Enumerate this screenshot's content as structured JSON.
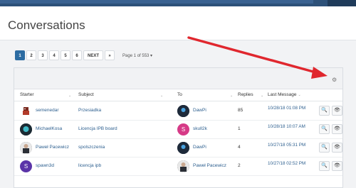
{
  "page": {
    "title": "Conversations"
  },
  "pagination": {
    "pages": [
      "1",
      "2",
      "3",
      "4",
      "5",
      "6"
    ],
    "active": "1",
    "next_label": "NEXT",
    "last_label": "»",
    "page_info": "Page 1 of 553 ▾"
  },
  "table": {
    "columns": [
      "Starter",
      "Subject",
      "To",
      "Replies",
      "Last Message"
    ],
    "rows": [
      {
        "starter": "semenedar",
        "subject": "Przesiadka",
        "to": "DawPi",
        "replies": "85",
        "last_message": "10/28/18 01:08 PM",
        "starter_avatar_color": "#a23a2a",
        "to_avatar_color": "#1e2a3a",
        "starter_initial": "",
        "to_initial": ""
      },
      {
        "starter": "MichaelKosa",
        "subject": "Licencja IPB board",
        "to": "skull2k",
        "replies": "1",
        "last_message": "10/28/18 10:07 AM",
        "starter_avatar_color": "#1b2a33",
        "to_avatar_color": "#d63a87",
        "starter_initial": "",
        "to_initial": "S"
      },
      {
        "starter": "Paweł Pacewicz",
        "subject": "spolszczenia",
        "to": "DawPi",
        "replies": "4",
        "last_message": "10/27/18 05:31 PM",
        "starter_avatar_color": "#2b2f36",
        "to_avatar_color": "#1e2a3a",
        "starter_initial": "",
        "to_initial": ""
      },
      {
        "starter": "spawn3d",
        "subject": "licencja ipb",
        "to": "Paweł Pacewicz",
        "replies": "2",
        "last_message": "10/27/18 02:52 PM",
        "starter_avatar_color": "#5b34a8",
        "to_avatar_color": "#2b2f36",
        "starter_initial": "S",
        "to_initial": ""
      }
    ]
  },
  "colors": {
    "accent": "#2d6ca2",
    "link": "#2d5f8f",
    "arrow": "#e0272e"
  },
  "icons": {
    "settings": "gear-icon",
    "view": "search-icon",
    "hide": "eye-slash-icon"
  }
}
